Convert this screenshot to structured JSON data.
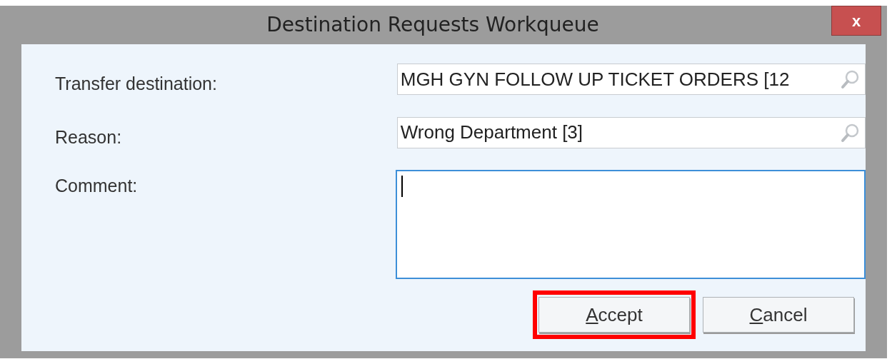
{
  "window": {
    "title": "Destination Requests Workqueue",
    "close": "x"
  },
  "fields": [
    {
      "kind": "lookup",
      "label": "Transfer destination:",
      "value": "MGH GYN FOLLOW UP TICKET ORDERS [12"
    },
    {
      "kind": "lookup",
      "label": "Reason:",
      "value": "Wrong Department [3]"
    },
    {
      "kind": "textarea",
      "label": "Comment:",
      "focused": true
    }
  ],
  "buttons": [
    {
      "label": "Accept",
      "highlighted": true,
      "access_key_underlined": true
    },
    {
      "label": "Cancel",
      "highlighted": false,
      "access_key_underlined": true
    }
  ]
}
